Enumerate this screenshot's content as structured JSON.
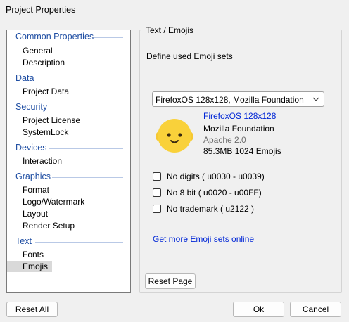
{
  "window": {
    "title": "Project Properties"
  },
  "tree": {
    "groups": [
      {
        "label": "Common Properties",
        "items": [
          "General",
          "Description"
        ]
      },
      {
        "label": "Data",
        "items": [
          "Project Data"
        ]
      },
      {
        "label": "Security",
        "items": [
          "Project License",
          "SystemLock"
        ]
      },
      {
        "label": "Devices",
        "items": [
          "Interaction"
        ]
      },
      {
        "label": "Graphics",
        "items": [
          "Format",
          "Logo/Watermark",
          "Layout",
          "Render Setup"
        ]
      },
      {
        "label": "Text",
        "items": [
          "Fonts",
          "Emojis"
        ]
      }
    ],
    "selected": "Emojis"
  },
  "page": {
    "title": "Text / Emojis",
    "description": "Define used Emoji sets",
    "dropdown_value": "FirefoxOS 128x128, Mozilla Foundation",
    "set_name": "FirefoxOS 128x128",
    "publisher": "Mozilla Foundation",
    "license": "Apache 2.0",
    "stats": "85.3MB 1024 Emojis",
    "options": [
      {
        "label": "No digits ( u0030 - u0039)",
        "checked": false
      },
      {
        "label": "No 8 bit ( u0020 - u00FF)",
        "checked": false
      },
      {
        "label": "No trademark ( u2122 )",
        "checked": false
      }
    ],
    "more_link": "Get more Emoji sets online",
    "reset_page": "Reset Page"
  },
  "footer": {
    "reset_all": "Reset All",
    "ok": "Ok",
    "cancel": "Cancel"
  }
}
